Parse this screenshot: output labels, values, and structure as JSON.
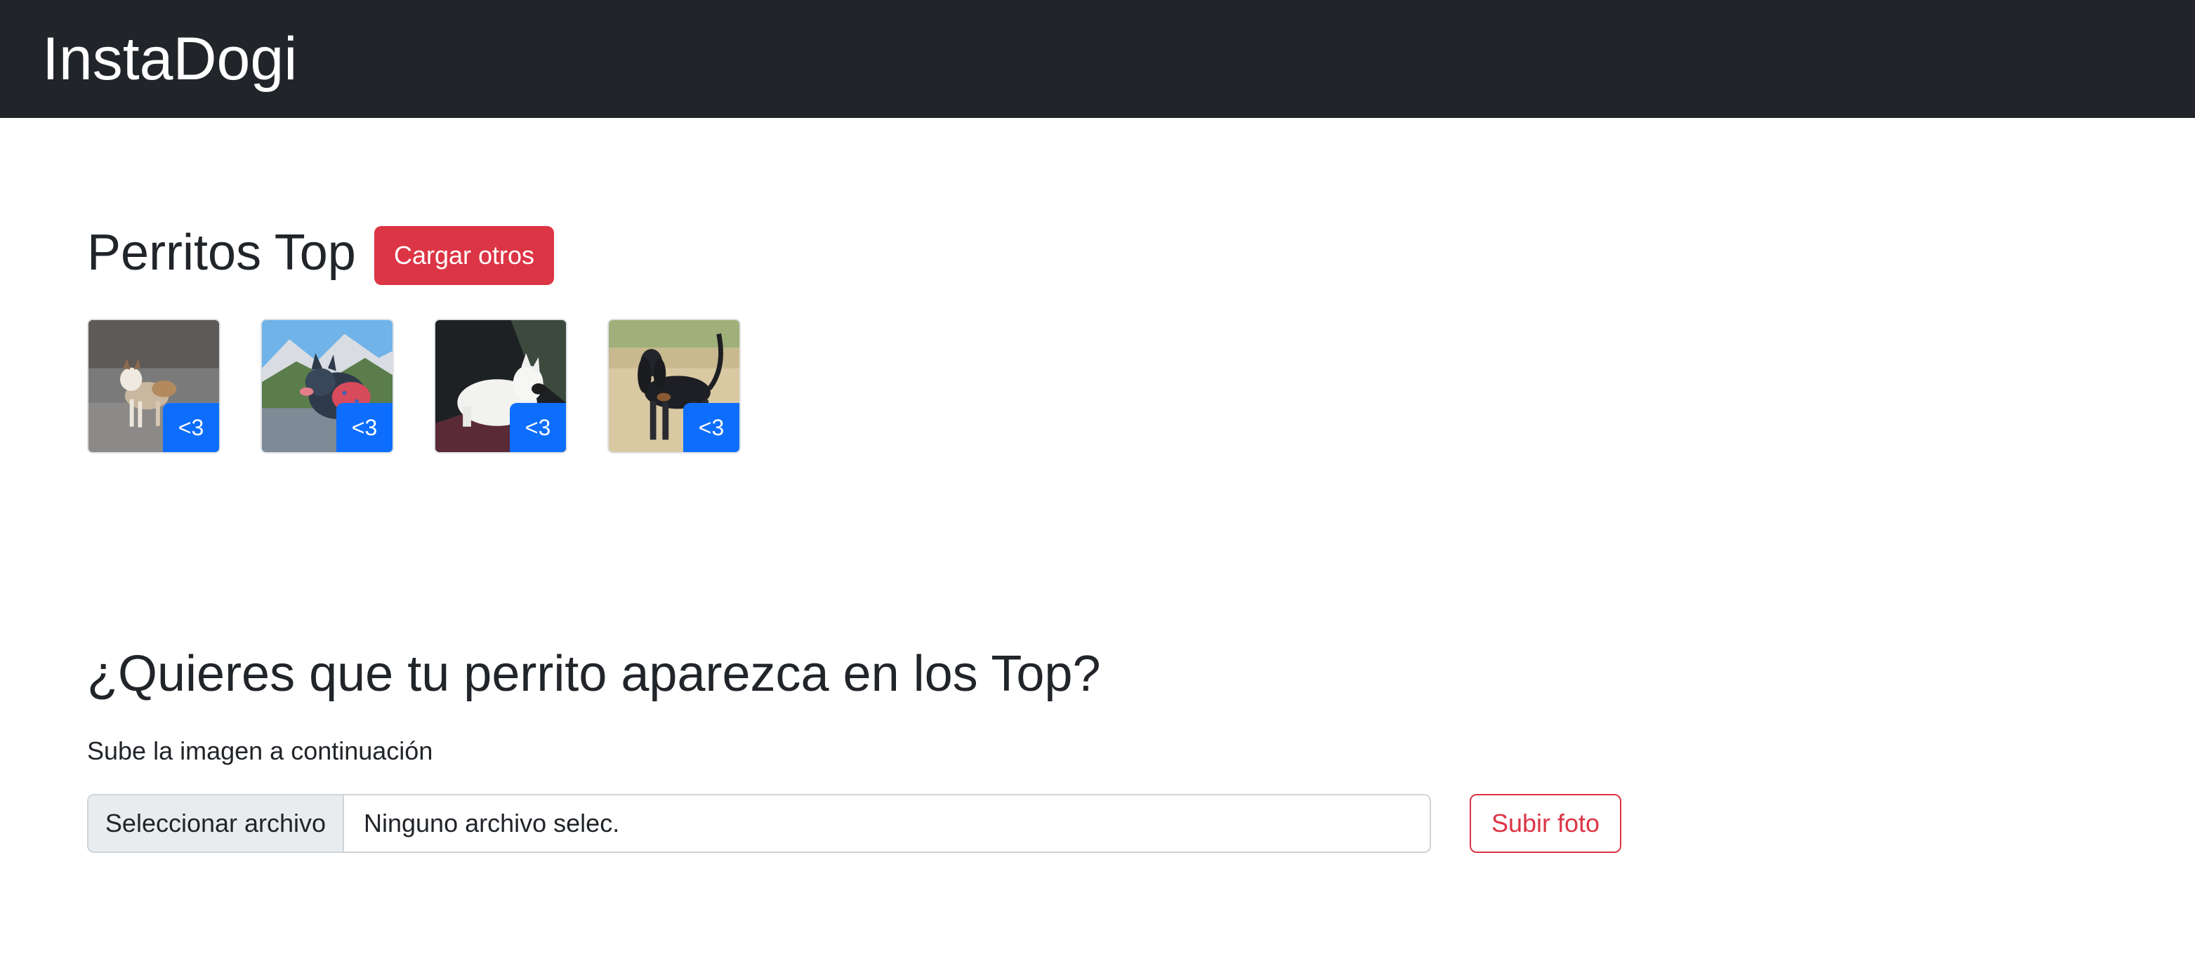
{
  "navbar": {
    "brand": "InstaDogi"
  },
  "top_section": {
    "title": "Perritos Top",
    "load_button_label": "Cargar otros",
    "dogs": [
      {
        "image": "akita-dog-photo",
        "like_label": "<3"
      },
      {
        "image": "blue-heeler-mountain-photo",
        "like_label": "<3"
      },
      {
        "image": "bull-terrier-photo",
        "like_label": "<3"
      },
      {
        "image": "coonhound-field-photo",
        "like_label": "<3"
      }
    ]
  },
  "upload_section": {
    "title": "¿Quieres que tu perrito aparezca en los Top?",
    "description": "Sube la imagen a continuación",
    "file_button_label": "Seleccionar archivo",
    "file_name_text": "Ninguno archivo selec.",
    "submit_label": "Subir foto"
  },
  "colors": {
    "navbar_bg": "#212529",
    "danger": "#dc3545",
    "primary": "#0d6efd",
    "input_addon_bg": "#e9ecef"
  }
}
